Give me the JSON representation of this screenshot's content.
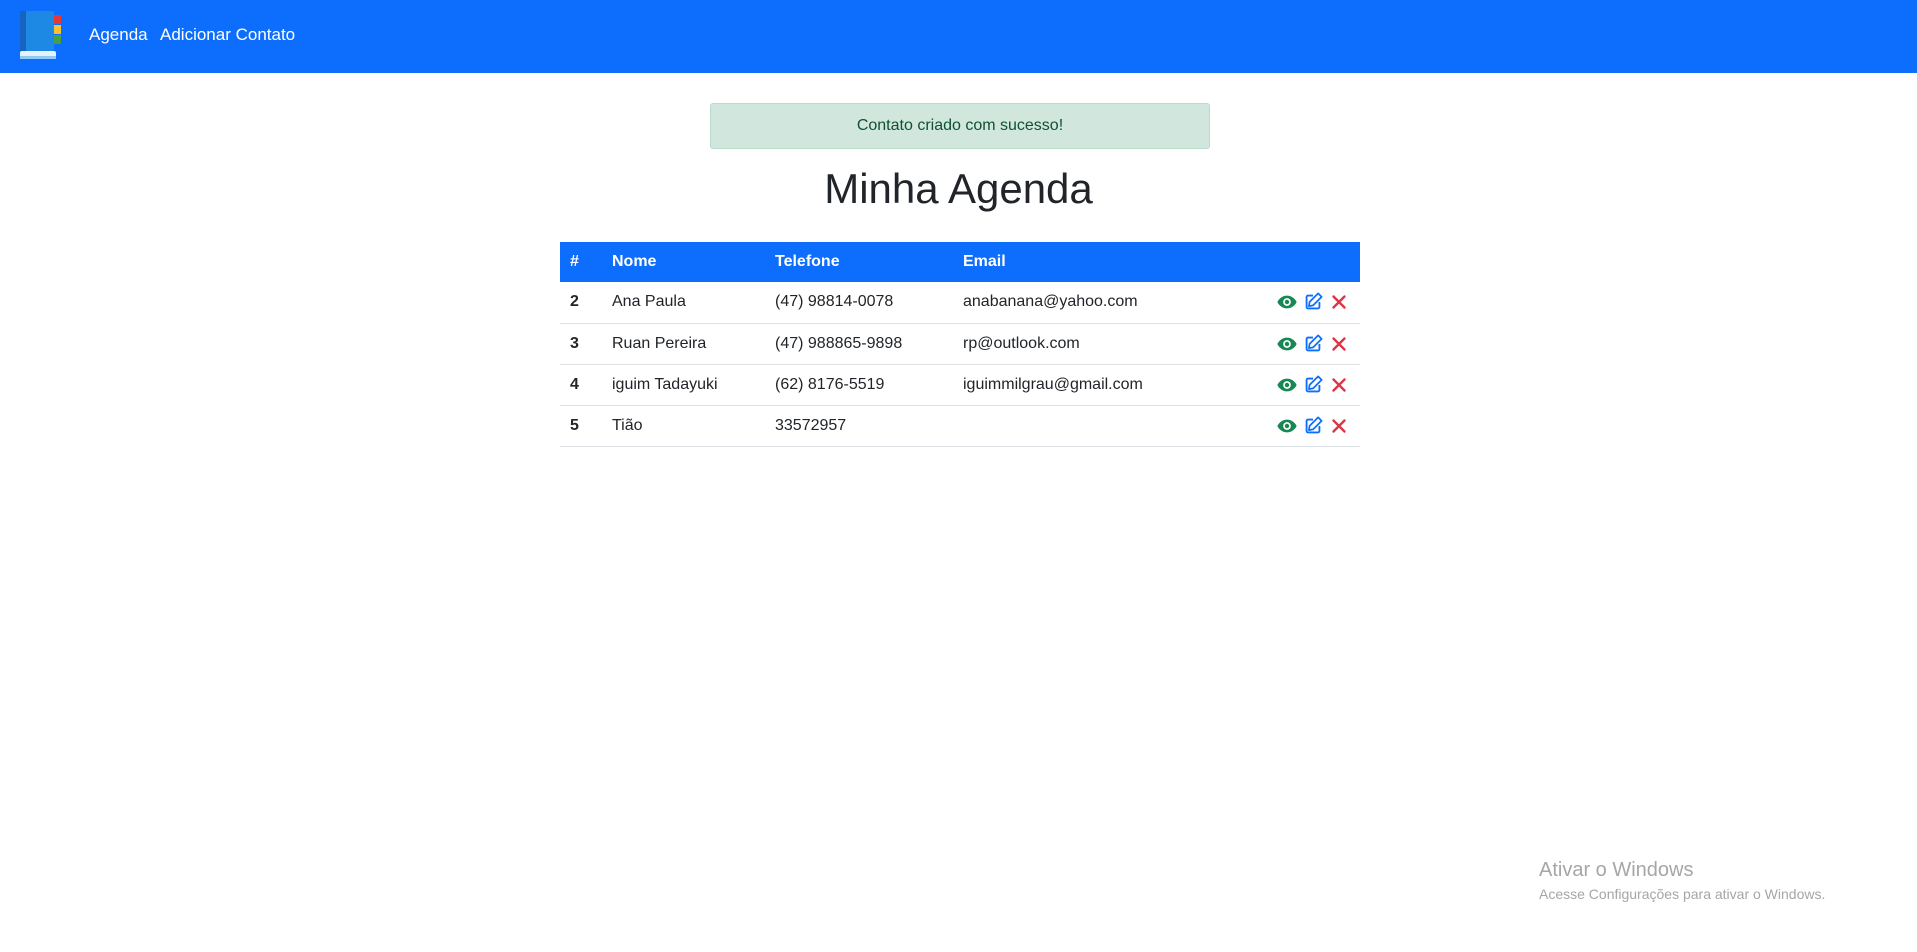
{
  "nav": {
    "logo_icon": "address-book-icon",
    "links": [
      "Agenda",
      "Adicionar Contato"
    ]
  },
  "alert": {
    "message": "Contato criado com sucesso!",
    "color": "#d1e7dd"
  },
  "page": {
    "title": "Minha Agenda"
  },
  "table": {
    "headers": [
      "#",
      "Nome",
      "Telefone",
      "Email",
      ""
    ],
    "rows": [
      {
        "id": "2",
        "nome": "Ana Paula",
        "telefone": "(47) 98814-0078",
        "email": "anabanana@yahoo.com"
      },
      {
        "id": "3",
        "nome": "Ruan Pereira",
        "telefone": "(47) 988865-9898",
        "email": "rp@outlook.com"
      },
      {
        "id": "4",
        "nome": "iguim Tadayuki",
        "telefone": "(62) 8176-5519",
        "email": "iguimmilgrau@gmail.com"
      },
      {
        "id": "5",
        "nome": "Tião",
        "telefone": "33572957",
        "email": ""
      }
    ],
    "action_icons": [
      "eye-icon",
      "edit-icon",
      "close-icon"
    ],
    "action_colors": {
      "view": "#198754",
      "edit": "#0d6efd",
      "delete": "#dc3545"
    }
  },
  "brand_color": "#0d6efd",
  "watermark": {
    "title": "Ativar o Windows",
    "subtitle": "Acesse Configurações para ativar o Windows."
  }
}
